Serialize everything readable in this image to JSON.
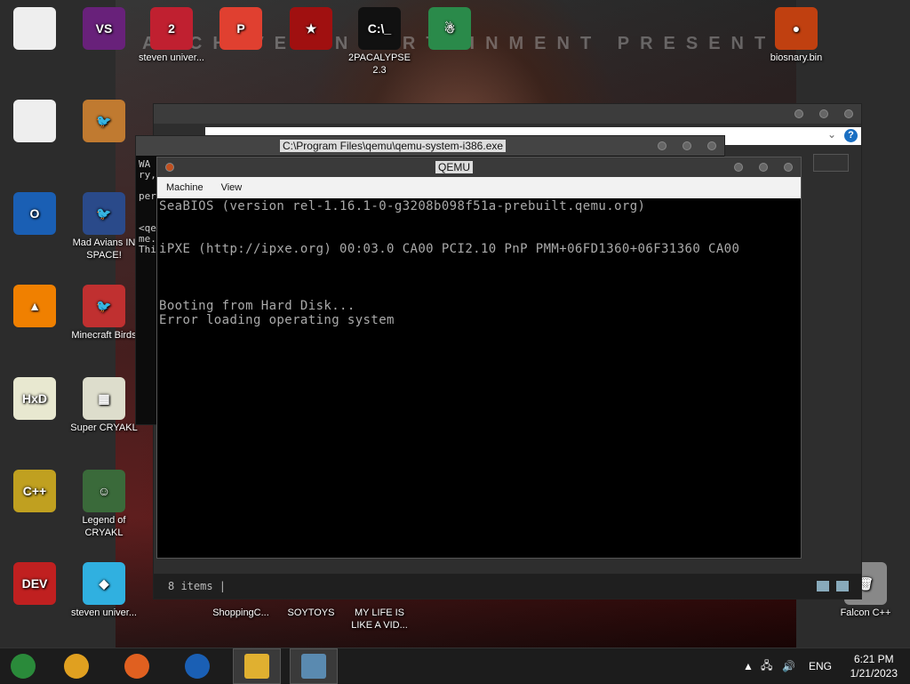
{
  "wallpaper": {
    "banner": "ARCHIVE ENTERTAINMENT PRESENT"
  },
  "desktop_icons": [
    {
      "label": "",
      "glyph": "",
      "color": "#eeeeee"
    },
    {
      "label": "",
      "glyph": "VS",
      "color": "#68217a"
    },
    {
      "label": "steven univer...",
      "glyph": "2",
      "color": "#c02030"
    },
    {
      "label": "",
      "glyph": "P",
      "color": "#e04030"
    },
    {
      "label": "",
      "glyph": "★",
      "color": "#a01010"
    },
    {
      "label": "2PACALYPSE 2.3",
      "glyph": "C:\\_",
      "color": "#111111"
    },
    {
      "label": "",
      "glyph": "☃",
      "color": "#2a8a4a"
    },
    {
      "label": "biosnary.bin",
      "glyph": "●",
      "color": "#c04010"
    },
    {
      "label": "",
      "glyph": "",
      "color": "#eeeeee"
    },
    {
      "label": "",
      "glyph": "🐦",
      "color": "#c07a30"
    },
    {
      "label": "",
      "glyph": "O",
      "color": "#1a5fb4"
    },
    {
      "label": "Mad Avians IN SPACE!",
      "glyph": "🐦",
      "color": "#2a4a8a"
    },
    {
      "label": "",
      "glyph": "▲",
      "color": "#f08000"
    },
    {
      "label": "Minecraft Birds",
      "glyph": "🐦",
      "color": "#c03030"
    },
    {
      "label": "",
      "glyph": "HxD",
      "color": "#e8e8d0"
    },
    {
      "label": "Super CRYAKL",
      "glyph": "▦",
      "color": "#ddddcc"
    },
    {
      "label": "",
      "glyph": "C++",
      "color": "#c0a020"
    },
    {
      "label": "Legend of CRYAKL",
      "glyph": "☺",
      "color": "#3a6a3a"
    },
    {
      "label": "",
      "glyph": "DEV",
      "color": "#c02020"
    },
    {
      "label": "steven univer...",
      "glyph": "◆",
      "color": "#30b0e0"
    },
    {
      "label": "",
      "glyph": "",
      "color": "transparent"
    },
    {
      "label": "ShoppingC...",
      "glyph": "",
      "color": "transparent"
    },
    {
      "label": "SOYTOYS",
      "glyph": "",
      "color": "transparent"
    },
    {
      "label": "MY LIFE IS LIKE A VID...",
      "glyph": "",
      "color": "transparent"
    },
    {
      "label": "Falcon C++",
      "glyph": "🗑",
      "color": "#888888"
    }
  ],
  "explorer": {
    "status": "8 items |",
    "help": "?",
    "chevron": "⌄"
  },
  "console": {
    "title": "C:\\Program Files\\qemu\\qemu-system-i386.exe",
    "text": "WA\nry,\n\nper\n\n\n<qe\nme.\nThi"
  },
  "qemu": {
    "title": "QEMU",
    "menu": [
      "Machine",
      "View"
    ],
    "lines": [
      "SeaBIOS (version rel-1.16.1-0-g3208b098f51a-prebuilt.qemu.org)",
      "iPXE (http://ipxe.org) 00:03.0 CA00 PCI2.10 PnP PMM+06FD1360+06F31360 CA00",
      "Booting from Hard Disk...",
      "Error loading operating system"
    ]
  },
  "taskbar": {
    "apps": [
      {
        "name": "chrome-dev",
        "color": "#2a8a3a"
      },
      {
        "name": "chrome",
        "color": "#e0a020"
      },
      {
        "name": "firefox",
        "color": "#e06020"
      },
      {
        "name": "obama",
        "color": "#1a5fb4"
      },
      {
        "name": "file-explorer",
        "color": "#e0b030"
      },
      {
        "name": "terminal",
        "color": "#5a8ab0"
      }
    ],
    "tray": {
      "lang": "ENG",
      "volume": "🔊",
      "network": "🖧",
      "chevron": "▲"
    },
    "time": "6:21 PM",
    "date": "1/21/2023"
  }
}
